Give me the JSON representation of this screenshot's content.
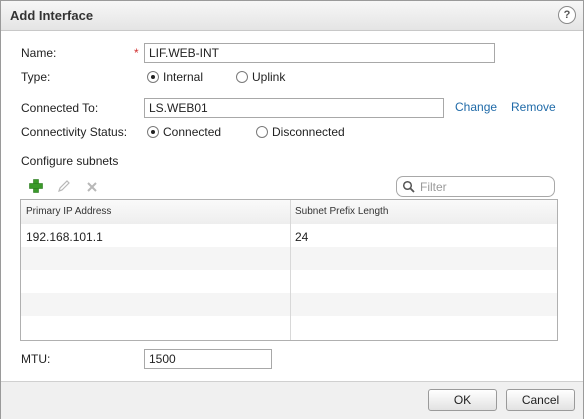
{
  "dialog": {
    "title": "Add Interface",
    "help_label": "?"
  },
  "form": {
    "name_label": "Name:",
    "required_marker": "*",
    "name_value": "LIF.WEB-INT",
    "type_label": "Type:",
    "type_options": [
      {
        "label": "Internal",
        "selected": true
      },
      {
        "label": "Uplink",
        "selected": false
      }
    ],
    "connected_to_label": "Connected To:",
    "connected_to_value": "LS.WEB01",
    "change_link": "Change",
    "remove_link": "Remove",
    "connectivity_label": "Connectivity Status:",
    "connectivity_options": [
      {
        "label": "Connected",
        "selected": true
      },
      {
        "label": "Disconnected",
        "selected": false
      }
    ],
    "subnets_label": "Configure subnets",
    "filter_placeholder": "Filter",
    "mtu_label": "MTU:",
    "mtu_value": "1500"
  },
  "toolbar": {
    "icons": [
      "add-icon",
      "edit-icon",
      "delete-icon"
    ],
    "add_color": "#3a9a2a"
  },
  "subnets_table": {
    "columns": [
      "Primary IP Address",
      "Subnet Prefix Length"
    ],
    "rows": [
      [
        "192.168.101.1",
        "24"
      ]
    ]
  },
  "buttons": {
    "ok": "OK",
    "cancel": "Cancel"
  },
  "colors": {
    "link": "#1f6aa8",
    "required": "#d03030"
  }
}
